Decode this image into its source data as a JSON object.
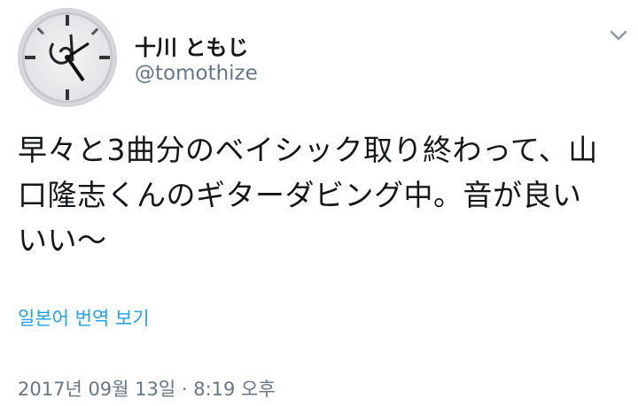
{
  "user": {
    "display_name": "十川 ともじ",
    "handle": "@tomothize",
    "avatar_icon": "watch-face-avatar-icon"
  },
  "menu": {
    "caret_icon": "chevron-down-icon"
  },
  "tweet": {
    "lines": [
      "早々と3曲分のベイシック取り終わって、山",
      "口隆志くんのギターダビング中。音が良い",
      "いい〜"
    ]
  },
  "translate": {
    "label": "일본어 번역 보기"
  },
  "meta": {
    "timestamp": "2017년 09월 13일 · 8:19 오후"
  },
  "colors": {
    "link": "#1da1f2",
    "secondary_text": "#657786",
    "primary_text": "#14171a"
  }
}
